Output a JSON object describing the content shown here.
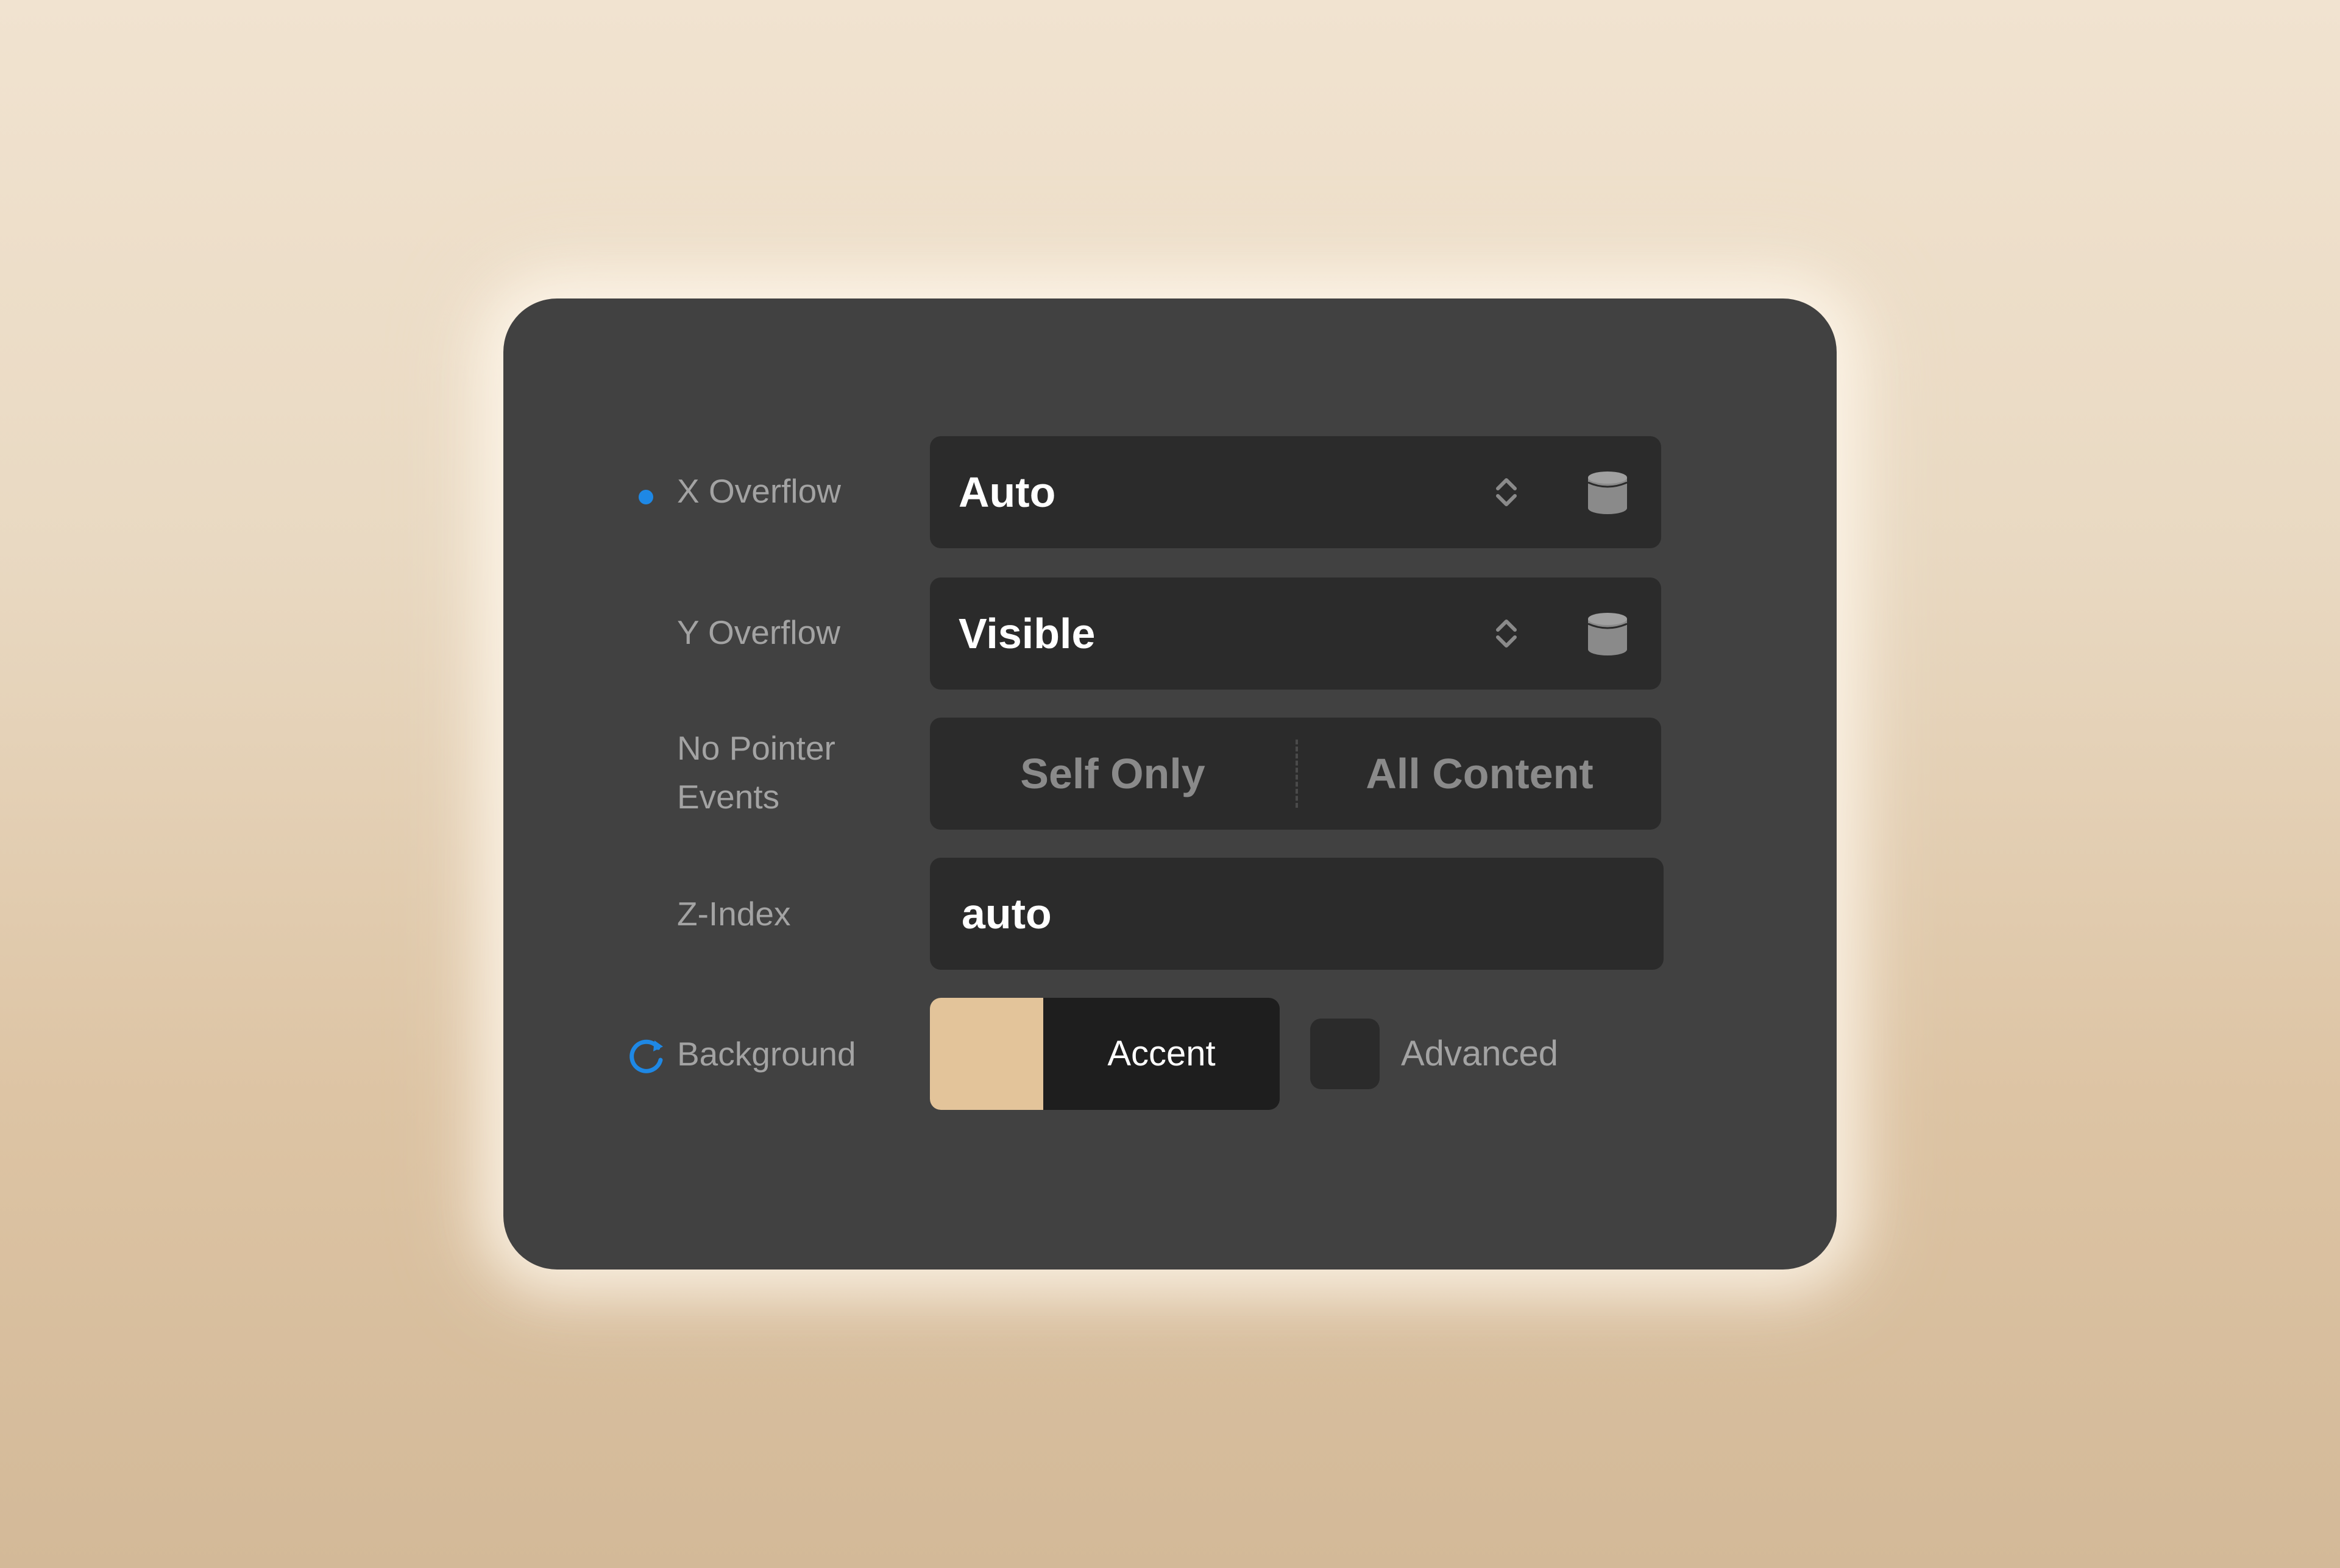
{
  "panel": {
    "rows": [
      {
        "label": "X Overflow",
        "value": "Auto",
        "modified": true
      },
      {
        "label": "Y Overflow",
        "value": "Visible"
      },
      {
        "label": "No Pointer Events",
        "options": [
          "Self Only",
          "All Content"
        ]
      },
      {
        "label": "Z-Index",
        "value": "auto"
      },
      {
        "label": "Background",
        "swatch_label": "Accent",
        "advanced_label": "Advanced"
      }
    ]
  },
  "icons": {
    "modified_indicator": "blue-dot",
    "stepper": "chevron-up-down-icon",
    "binding": "database-icon",
    "background_sync": "sync-icon"
  },
  "colors": {
    "panel_bg": "#414141",
    "field_bg": "#2b2b2b",
    "accent_blue": "#1e88e5",
    "swatch": "#e3c49a"
  }
}
